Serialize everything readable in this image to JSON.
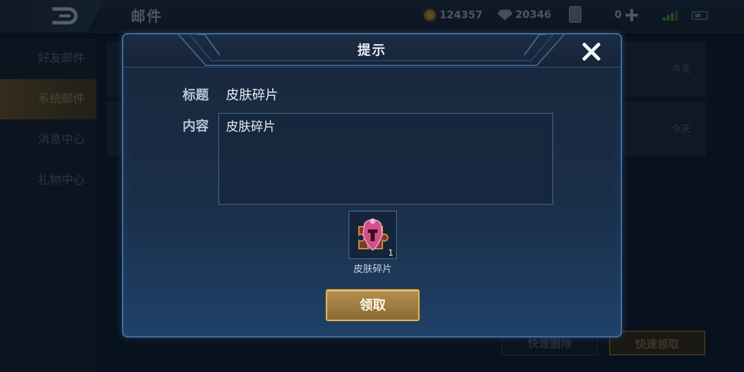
{
  "topbar": {
    "title": "邮件",
    "gold": "124357",
    "diamonds": "20346",
    "vouchers": "0"
  },
  "sidenav": {
    "items": [
      {
        "label": "好友邮件"
      },
      {
        "label": "系统邮件"
      },
      {
        "label": "消息中心"
      },
      {
        "label": "礼物中心"
      }
    ]
  },
  "mail_list": {
    "rows": [
      {
        "time": "今天"
      },
      {
        "time": "今天"
      }
    ]
  },
  "footer": {
    "delete_label": "快速删除",
    "claim_all_label": "快速领取"
  },
  "modal": {
    "title": "提示",
    "subject_label": "标题",
    "subject_value": "皮肤碎片",
    "content_label": "内容",
    "content_value": "皮肤碎片",
    "attachment": {
      "name": "皮肤碎片",
      "count": "1"
    },
    "claim_label": "领取"
  }
}
